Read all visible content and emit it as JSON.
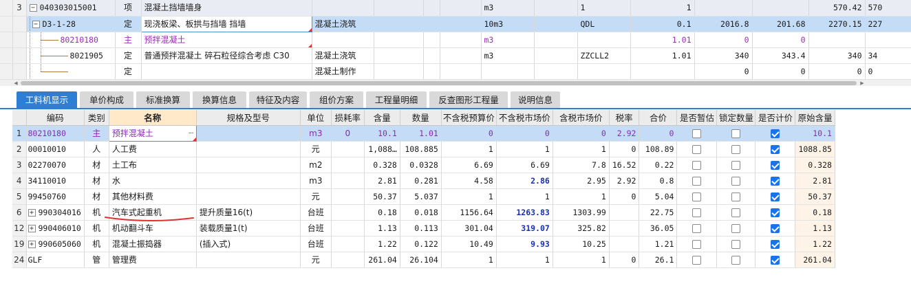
{
  "top_grid": {
    "rows": [
      {
        "num": "3",
        "expander": "−",
        "code": "040303015001",
        "type": "项",
        "name": "混凝土挡墙墙身",
        "spec": "",
        "has_checkbox": true,
        "unit": "m3",
        "qty_expr": "1",
        "qty": "1",
        "c1": "",
        "c2": "",
        "c3": "570.42",
        "c4": "570"
      },
      {
        "num": "",
        "expander": "−",
        "code": "D3-1-28",
        "type": "定",
        "name": "现浇板梁、板拱与挡墙 挡墙",
        "spec": "混凝土浇筑",
        "unit": "10m3",
        "qty_expr": "QDL",
        "qty": "0.1",
        "c1": "2016.8",
        "c2": "201.68",
        "c3": "2270.15",
        "c4": "227"
      },
      {
        "num": "",
        "code": "80210180",
        "type": "主",
        "name": "预拌混凝土",
        "spec": "",
        "unit": "m3",
        "qty_expr": "",
        "qty": "1.01",
        "c1": "0",
        "c2": "0",
        "c3": "",
        "c4": ""
      },
      {
        "num": "",
        "code": "8021905",
        "type": "定",
        "name": "普通预拌混凝土 碎石粒径综合考虑 C30",
        "spec": "混凝土浇筑",
        "unit": "m3",
        "qty_expr": "ZZCLL2",
        "qty": "1.01",
        "c1": "340",
        "c2": "343.4",
        "c3": "340",
        "c4": "34"
      },
      {
        "num": "",
        "code": "",
        "type": "定",
        "name": "",
        "spec": "混凝土制作",
        "unit": "",
        "qty_expr": "",
        "qty": "",
        "c1": "0",
        "c2": "0",
        "c3": "0",
        "c4": "0"
      }
    ]
  },
  "tabs": [
    "工料机显示",
    "单价构成",
    "标准换算",
    "换算信息",
    "特征及内容",
    "组价方案",
    "工程量明细",
    "反查图形工程量",
    "说明信息"
  ],
  "active_tab": "工料机显示",
  "detail_table": {
    "headers": [
      "编码",
      "类别",
      "名称",
      "规格及型号",
      "单位",
      "损耗率",
      "含量",
      "数量",
      "不含税预算价",
      "不含税市场价",
      "含税市场价",
      "税率",
      "合价",
      "是否暂估",
      "锁定数量",
      "是否计价",
      "原始含量"
    ],
    "rows": [
      {
        "num": "1",
        "expander": "",
        "code": "80210180",
        "cat": "主",
        "name": "预拌混凝土",
        "spec": "",
        "unit": "m3",
        "loss": "0",
        "content": "10.1",
        "qty": "1.01",
        "budget": "0",
        "market": "0",
        "tax_market": "0",
        "tax": "2.92",
        "total": "0",
        "est": false,
        "lock": false,
        "priced": true,
        "orig": "10.1",
        "market_bold": false
      },
      {
        "num": "2",
        "expander": "",
        "code": "00010010",
        "cat": "人",
        "name": "人工费",
        "spec": "",
        "unit": "元",
        "loss": "",
        "content": "1,088…",
        "qty": "108.885",
        "budget": "1",
        "market": "1",
        "tax_market": "1",
        "tax": "0",
        "total": "108.89",
        "est": false,
        "lock": false,
        "priced": true,
        "orig": "1088.85",
        "market_bold": false
      },
      {
        "num": "3",
        "expander": "",
        "code": "02270070",
        "cat": "材",
        "name": "土工布",
        "spec": "",
        "unit": "m2",
        "loss": "",
        "content": "0.328",
        "qty": "0.0328",
        "budget": "6.69",
        "market": "6.69",
        "tax_market": "7.8",
        "tax": "16.52",
        "total": "0.22",
        "est": false,
        "lock": false,
        "priced": true,
        "orig": "0.328",
        "market_bold": false
      },
      {
        "num": "4",
        "expander": "",
        "code": "34110010",
        "cat": "材",
        "name": "水",
        "spec": "",
        "unit": "m3",
        "loss": "",
        "content": "2.81",
        "qty": "0.281",
        "budget": "4.58",
        "market": "2.86",
        "tax_market": "2.95",
        "tax": "2.92",
        "total": "0.8",
        "est": false,
        "lock": false,
        "priced": true,
        "orig": "2.81",
        "market_bold": true
      },
      {
        "num": "5",
        "expander": "",
        "code": "99450760",
        "cat": "材",
        "name": "其他材料费",
        "spec": "",
        "unit": "元",
        "loss": "",
        "content": "50.37",
        "qty": "5.037",
        "budget": "1",
        "market": "1",
        "tax_market": "1",
        "tax": "0",
        "total": "5.04",
        "est": false,
        "lock": false,
        "priced": true,
        "orig": "50.37",
        "market_bold": false
      },
      {
        "num": "6",
        "expander": "+",
        "code": "990304016",
        "cat": "机",
        "name": "汽车式起重机",
        "spec": "提升质量16(t)",
        "unit": "台班",
        "loss": "",
        "content": "0.18",
        "qty": "0.018",
        "budget": "1156.64",
        "market": "1263.83",
        "tax_market": "1303.99",
        "tax": "",
        "total": "22.75",
        "est": false,
        "lock": false,
        "priced": true,
        "orig": "0.18",
        "market_bold": true
      },
      {
        "num": "12",
        "expander": "+",
        "code": "990406010",
        "cat": "机",
        "name": "机动翻斗车",
        "spec": "装载质量1(t)",
        "unit": "台班",
        "loss": "",
        "content": "1.13",
        "qty": "0.113",
        "budget": "301.04",
        "market": "319.07",
        "tax_market": "325.82",
        "tax": "",
        "total": "36.05",
        "est": false,
        "lock": false,
        "priced": true,
        "orig": "1.13",
        "market_bold": true
      },
      {
        "num": "19",
        "expander": "+",
        "code": "990605060",
        "cat": "机",
        "name": "混凝土振捣器",
        "spec": "(插入式)",
        "unit": "台班",
        "loss": "",
        "content": "1.22",
        "qty": "0.122",
        "budget": "10.49",
        "market": "9.93",
        "tax_market": "10.25",
        "tax": "",
        "total": "1.21",
        "est": false,
        "lock": false,
        "priced": true,
        "orig": "1.22",
        "market_bold": true
      },
      {
        "num": "24",
        "expander": "",
        "code": "GLF",
        "cat": "管",
        "name": "管理费",
        "spec": "",
        "unit": "元",
        "loss": "",
        "content": "261.04",
        "qty": "26.104",
        "budget": "1",
        "market": "1",
        "tax_market": "1",
        "tax": "0",
        "total": "26.1",
        "est": false,
        "lock": false,
        "priced": true,
        "orig": "261.04",
        "market_bold": false
      }
    ]
  },
  "colors": {
    "accent": "#2e7fd4",
    "selected_row": "#c5dcf6",
    "main_material_text": "#9a2ab6",
    "bold_price": "#1a2fb0",
    "annotation": "#e03030"
  }
}
